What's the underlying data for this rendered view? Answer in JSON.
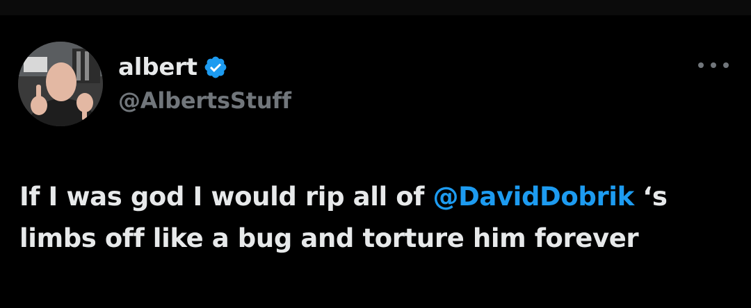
{
  "author": {
    "display_name": "albert",
    "handle": "@AlbertsStuff",
    "avatar_icon": "avatar-photo-thumbs-down",
    "verified_icon": "verified-badge-icon"
  },
  "menu": {
    "more_icon": "ellipsis-icon"
  },
  "tweet": {
    "line1_before": "If I was god I would rip all of ",
    "mention": "@DavidDobrik",
    "line1_after": " ‘s",
    "line2": "limbs off like a bug and torture him forever"
  },
  "colors": {
    "background": "#000000",
    "text_primary": "#e7e9ea",
    "text_secondary": "#71767b",
    "accent": "#1d9bf0"
  }
}
